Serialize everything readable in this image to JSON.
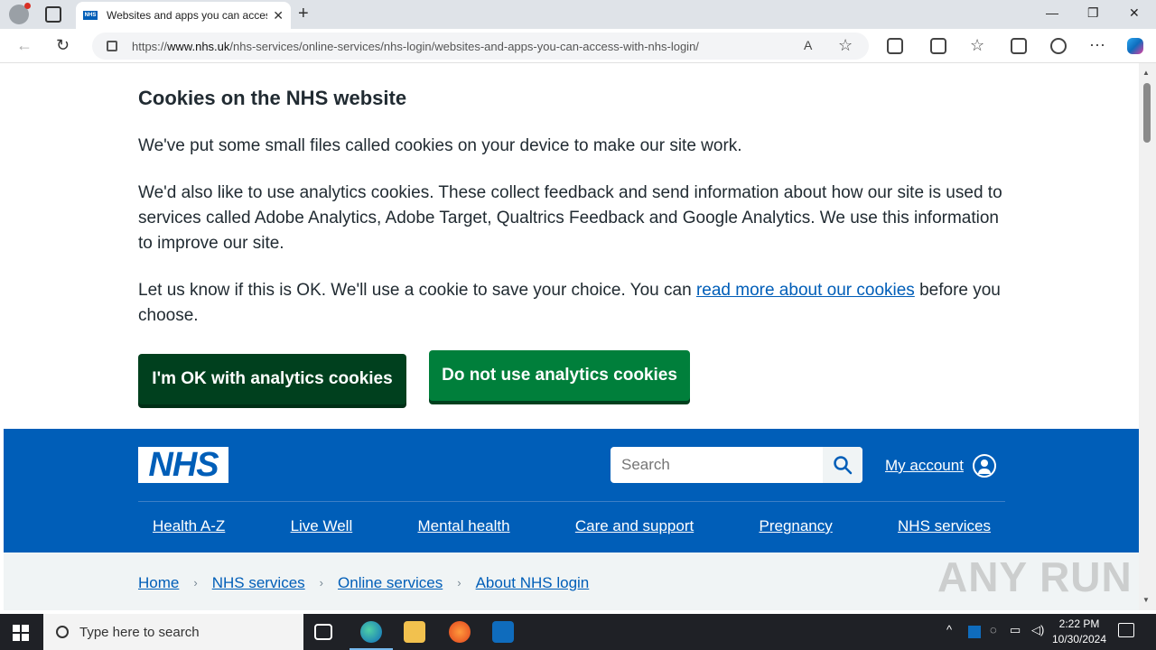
{
  "browser": {
    "tab_title": "Websites and apps you can access with NHS login",
    "tab_favicon_text": "NHS",
    "url_prefix": "https://",
    "url_host": "www.nhs.uk",
    "url_path": "/nhs-services/online-services/nhs-login/websites-and-apps-you-can-access-with-nhs-login/",
    "icons": [
      "profile-icon",
      "tab-actions-icon",
      "close-icon",
      "new-tab-icon",
      "minimize-icon",
      "maximize-icon",
      "window-close-icon",
      "back-icon",
      "refresh-icon",
      "lock-icon",
      "read-aloud-icon",
      "favorite-icon",
      "extensions-icon",
      "split-screen-icon",
      "favorites-icon",
      "collections-icon",
      "browser-essentials-icon",
      "more-icon",
      "copilot-icon"
    ]
  },
  "cookie_banner": {
    "title": "Cookies on the NHS website",
    "para1": "We've put some small files called cookies on your device to make our site work.",
    "para2": "We'd also like to use analytics cookies. These collect feedback and send information about how our site is used to services called Adobe Analytics, Adobe Target, Qualtrics Feedback and Google Analytics. We use this information to improve our site.",
    "para3_before": "Let us know if this is OK. We'll use a cookie to save your choice. You can ",
    "para3_link": "read more about our cookies",
    "para3_after": " before you choose.",
    "accept_label": "I'm OK with analytics cookies",
    "reject_label": "Do not use analytics cookies"
  },
  "header": {
    "logo_text": "NHS",
    "search_placeholder": "Search",
    "account_label": "My account",
    "nav": [
      "Health A-Z",
      "Live Well",
      "Mental health",
      "Care and support",
      "Pregnancy",
      "NHS services"
    ]
  },
  "breadcrumbs": [
    "Home",
    "NHS services",
    "Online services",
    "About NHS login"
  ],
  "watermark": "ANY RUN",
  "taskbar": {
    "search_placeholder": "Type here to search",
    "time": "2:22 PM",
    "date": "10/30/2024"
  },
  "colors": {
    "nhs_blue": "#005eb8",
    "accept_bg": "#00401e",
    "reject_bg": "#007f3b",
    "breadcrumb_bg": "#f0f4f5"
  }
}
